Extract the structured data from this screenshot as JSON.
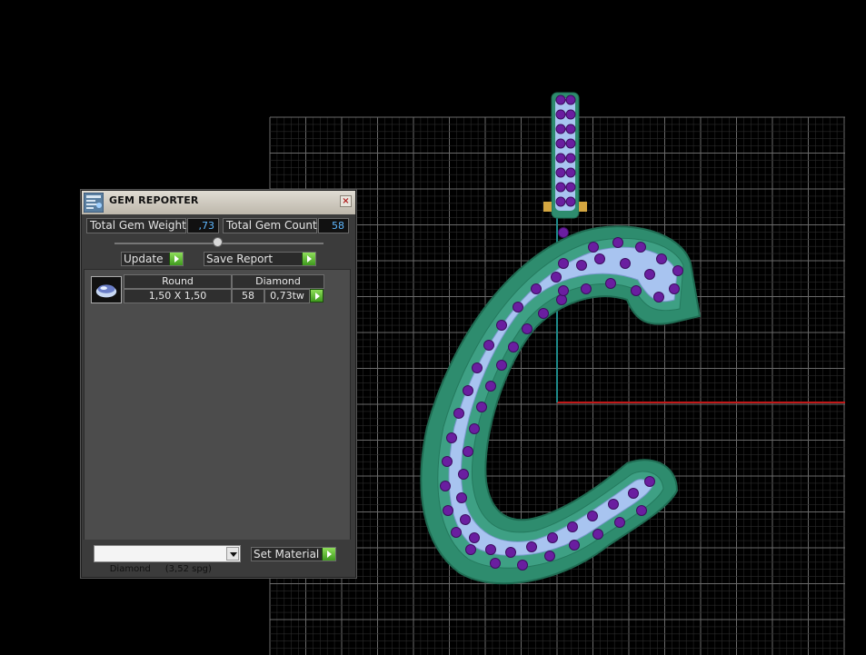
{
  "window": {
    "title": "GEM REPORTER",
    "close_label": "×"
  },
  "summary": {
    "weight_label": "Total Gem Weight",
    "weight_value": ",73",
    "count_label": "Total Gem Count",
    "count_value": "58"
  },
  "buttons": {
    "update_label": "Update",
    "save_report_label": "Save Report",
    "set_material_label": "Set Material"
  },
  "gem_list": {
    "headers": [
      "Round",
      "Diamond"
    ],
    "rows": [
      {
        "size": "1,50 X 1,50",
        "count": "58",
        "weight": "0,73tw"
      }
    ]
  },
  "material_select": {
    "value": "Diamond     (3,52 spg)"
  },
  "colors": {
    "background": "#000000",
    "grid": "#4a4a4a",
    "panel": "#3b3b3b",
    "value_text": "#5fb8ff",
    "model_band": "#2e8c6e",
    "model_pave": "#a8c4f0",
    "gem_purple": "#6a1ea0",
    "axis_x": "#c01818",
    "axis_y": "#1e8a8a"
  },
  "icons": {
    "app": "gem-reporter-icon",
    "close": "close-icon",
    "go": "play-arrow-icon",
    "gem": "round-gem-icon",
    "dropdown": "chevron-down-icon"
  }
}
